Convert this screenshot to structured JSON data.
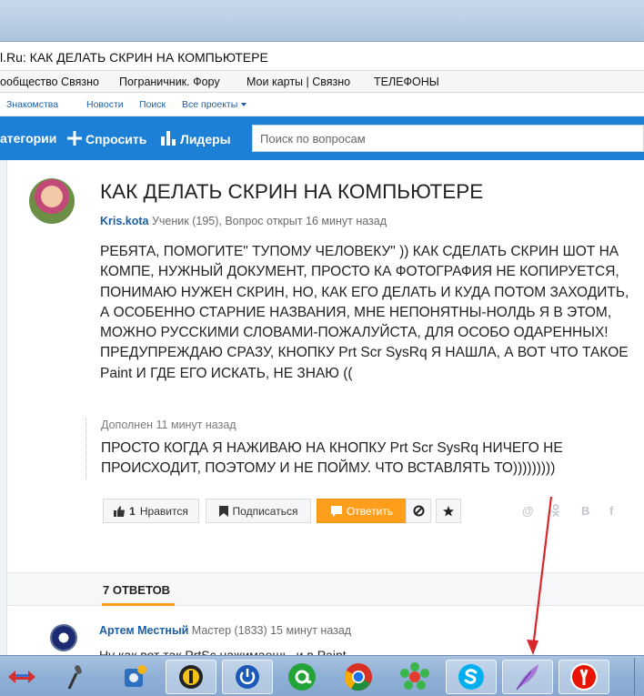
{
  "address_bar": {
    "text": "l.Ru: КАК ДЕЛАТЬ СКРИН НА КОМПЬЮТЕРЕ"
  },
  "bookmarks": [
    {
      "label": "ообщество Связно"
    },
    {
      "label": "Пограничник. Фору"
    },
    {
      "label": "Мои карты | Связно"
    },
    {
      "label": "ТЕЛЕФОНЫ"
    }
  ],
  "site_nav": {
    "links": [
      "Знакомства",
      "Новости",
      "Поиск"
    ],
    "all_projects": "Все проекты"
  },
  "header": {
    "categories": "атегории",
    "ask": "Спросить",
    "leaders": "Лидеры",
    "search_placeholder": "Поиск по вопросам"
  },
  "question": {
    "title": "КАК ДЕЛАТЬ СКРИН НА КОМПЬЮТЕРЕ",
    "author": "Kris.kota",
    "meta": " Ученик (195), Вопрос открыт 16 минут назад",
    "body": "РЕБЯТА, ПОМОГИТЕ\" ТУПОМУ ЧЕЛОВЕКУ\" )) КАК СДЕЛАТЬ СКРИН ШОТ НА КОМПЕ, НУЖНЫЙ ДОКУМЕНТ, ПРОСТО КА ФОТОГРАФИЯ НЕ КОПИРУЕТСЯ, ПОНИМАЮ НУЖЕН СКРИН, НО, КАК ЕГО ДЕЛАТЬ И КУДА ПОТОМ ЗАХОДИТЬ, А ОСОБЕННО СТАРНИЕ НАЗВАНИЯ, МНЕ НЕПОНЯТНЫ-НОЛДЬ Я В ЭТОМ, МОЖНО РУССКИМИ СЛОВАМИ-ПОЖАЛУЙСТА, ДЛЯ ОСОБО ОДАРЕННЫХ! ПРЕДУПРЕЖДАЮ СРАЗУ, КНОПКУ Prt Scr SysRq Я НАШЛА, А ВОТ ЧТО ТАКОЕ Paint И ГДЕ ЕГО ИСКАТЬ, НЕ ЗНАЮ ((",
    "addition_label": "Дополнен 11 минут назад",
    "addition_text": "ПРОСТО КОГДА Я НАЖИВАЮ НА КНОПКУ Prt Scr SysRq НИЧЕГО НЕ ПРОИСХОДИТ, ПОЭТОМУ И НЕ ПОЙМУ. ЧТО ВСТАВЛЯТЬ ТО)))))))))"
  },
  "actions": {
    "like_count": "1",
    "like_label": "Нравится",
    "subscribe": "Подписаться",
    "answer": "Ответить"
  },
  "share_icons": [
    "@",
    "ok",
    "В",
    "f"
  ],
  "answers": {
    "header": "7 ОТВЕТОВ",
    "first": {
      "author": "Артем Местный",
      "meta": " Мастер (1833) 15 минут назад",
      "text_partial": "Ну как вот так PrtSc нажимаешь, и в Paint вставляешь"
    }
  },
  "taskbar": {
    "icons": [
      "network-arrows-icon",
      "microphone-icon",
      "settings-tools-icon",
      "radio-icon",
      "power-icon",
      "mail-ru-agent-icon",
      "chrome-icon",
      "icq-icon",
      "skype-icon",
      "quill-icon",
      "yandex-browser-icon"
    ],
    "active": [
      "radio-icon",
      "power-icon",
      "skype-icon",
      "quill-icon",
      "yandex-browser-icon"
    ]
  },
  "colors": {
    "brand_blue": "#1d80d7",
    "link_blue": "#1a5fa6",
    "accent_orange": "#ff9e1b",
    "annotation_red": "#d8262b"
  }
}
